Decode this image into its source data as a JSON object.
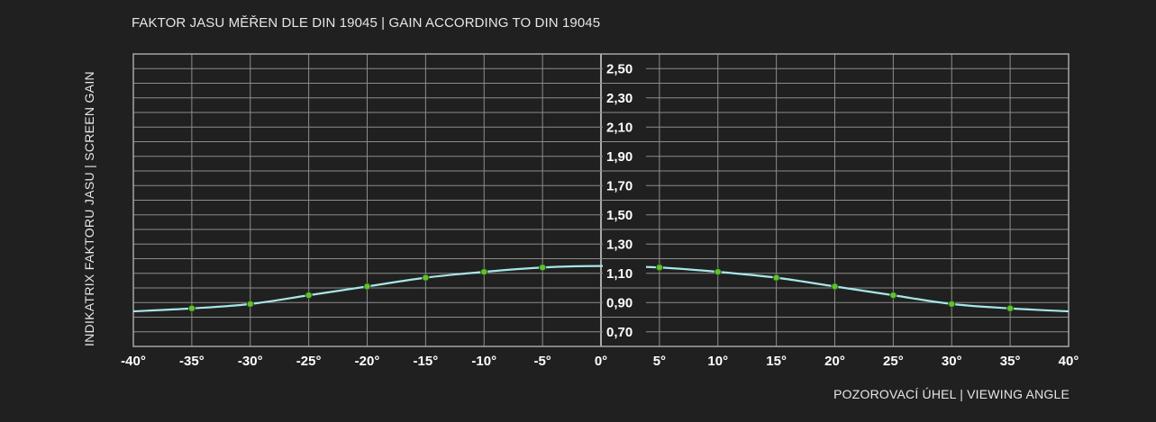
{
  "chart_data": {
    "type": "line",
    "title": "FAKTOR JASU MĚŘEN DLE DIN 19045 | GAIN ACCORDING TO DIN 19045",
    "xlabel": "POZOROVACÍ ÚHEL | VIEWING ANGLE",
    "ylabel": "INDIKATRIX FAKTORU JASU | SCREEN GAIN",
    "xlim": [
      -40,
      40
    ],
    "ylim": [
      0.6,
      2.6
    ],
    "x_ticks": [
      -40,
      -35,
      -30,
      -25,
      -20,
      -15,
      -10,
      -5,
      0,
      5,
      10,
      15,
      20,
      25,
      30,
      35,
      40
    ],
    "x_tick_labels": [
      "-40°",
      "-35°",
      "-30°",
      "-25°",
      "-20°",
      "-15°",
      "-10°",
      "-5°",
      "0°",
      "5°",
      "10°",
      "15°",
      "20°",
      "25°",
      "30°",
      "35°",
      "40°"
    ],
    "y_ticks": [
      0.7,
      0.9,
      1.1,
      1.3,
      1.5,
      1.7,
      1.9,
      2.1,
      2.3,
      2.5
    ],
    "y_tick_labels": [
      "0,70",
      "0,90",
      "1,10",
      "1,30",
      "1,50",
      "1,70",
      "1,90",
      "2,10",
      "2,30",
      "2,50"
    ],
    "grid": true,
    "series": [
      {
        "x": [
          -35,
          -30,
          -25,
          -20,
          -15,
          -10,
          -5,
          5,
          10,
          15,
          20,
          25,
          30,
          35
        ],
        "values": [
          0.86,
          0.89,
          0.95,
          1.01,
          1.07,
          1.11,
          1.14,
          1.14,
          1.11,
          1.07,
          1.01,
          0.95,
          0.89,
          0.86
        ],
        "curve_values": [
          0.84,
          0.86,
          0.89,
          0.95,
          1.01,
          1.07,
          1.11,
          1.14,
          1.15,
          1.14,
          1.11,
          1.07,
          1.01,
          0.95,
          0.89,
          0.86,
          0.84
        ],
        "line_color": "#a8e6e8",
        "marker_color": "#5fc12e"
      }
    ]
  }
}
